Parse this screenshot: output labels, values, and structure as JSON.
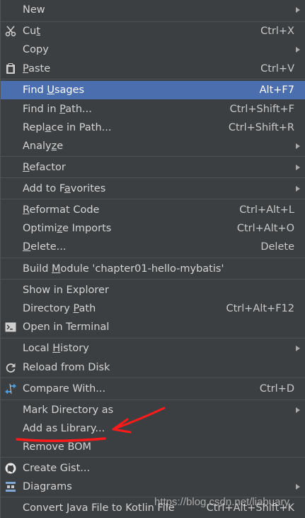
{
  "menu": {
    "new": {
      "label": "New"
    },
    "cut": {
      "pre": "Cu",
      "mn": "t",
      "post": "",
      "shortcut": "Ctrl+X"
    },
    "copy": {
      "label": "Copy"
    },
    "paste": {
      "pre": "",
      "mn": "P",
      "post": "aste",
      "shortcut": "Ctrl+V"
    },
    "find_usages": {
      "pre": "Find ",
      "mn": "U",
      "post": "sages",
      "shortcut": "Alt+F7"
    },
    "find_in_path": {
      "pre": "Find in ",
      "mn": "P",
      "post": "ath...",
      "shortcut": "Ctrl+Shift+F"
    },
    "replace_in_path": {
      "pre": "Repl",
      "mn": "a",
      "post": "ce in Path...",
      "shortcut": "Ctrl+Shift+R"
    },
    "analyze": {
      "pre": "Analy",
      "mn": "z",
      "post": "e"
    },
    "refactor": {
      "pre": "",
      "mn": "R",
      "post": "efactor"
    },
    "add_favorites": {
      "pre": "Add to F",
      "mn": "a",
      "post": "vorites"
    },
    "reformat": {
      "pre": "",
      "mn": "R",
      "post": "eformat Code",
      "shortcut": "Ctrl+Alt+L"
    },
    "optimize": {
      "pre": "Optimi",
      "mn": "z",
      "post": "e Imports",
      "shortcut": "Ctrl+Alt+O"
    },
    "delete": {
      "pre": "",
      "mn": "D",
      "post": "elete...",
      "shortcut": "Delete"
    },
    "build_module": {
      "pre": "Build ",
      "mn": "M",
      "post": "odule 'chapter01-hello-mybatis'"
    },
    "show_explorer": {
      "label": "Show in Explorer"
    },
    "directory_path": {
      "pre": "Directory ",
      "mn": "P",
      "post": "ath",
      "shortcut": "Ctrl+Alt+F12"
    },
    "open_terminal": {
      "label": "Open in Terminal"
    },
    "local_history": {
      "pre": "Local ",
      "mn": "H",
      "post": "istory"
    },
    "reload_disk": {
      "label": "Reload from Disk"
    },
    "compare_with": {
      "label": "Compare With...",
      "shortcut": "Ctrl+D"
    },
    "mark_directory": {
      "label": "Mark Directory as"
    },
    "add_library": {
      "label": "Add as Library..."
    },
    "remove_bom": {
      "label": "Remove BOM"
    },
    "create_gist": {
      "label": "Create Gist..."
    },
    "diagrams": {
      "label": "Diagrams"
    },
    "convert_kotlin": {
      "label": "Convert Java File to Kotlin File",
      "shortcut": "Ctrl+Alt+Shift+K"
    }
  },
  "watermark": "https://blog.csdn.net/liabuary",
  "colors": {
    "background": "#3c3f41",
    "selection": "#4b6eaf",
    "annotation": "#ff1a1a"
  }
}
